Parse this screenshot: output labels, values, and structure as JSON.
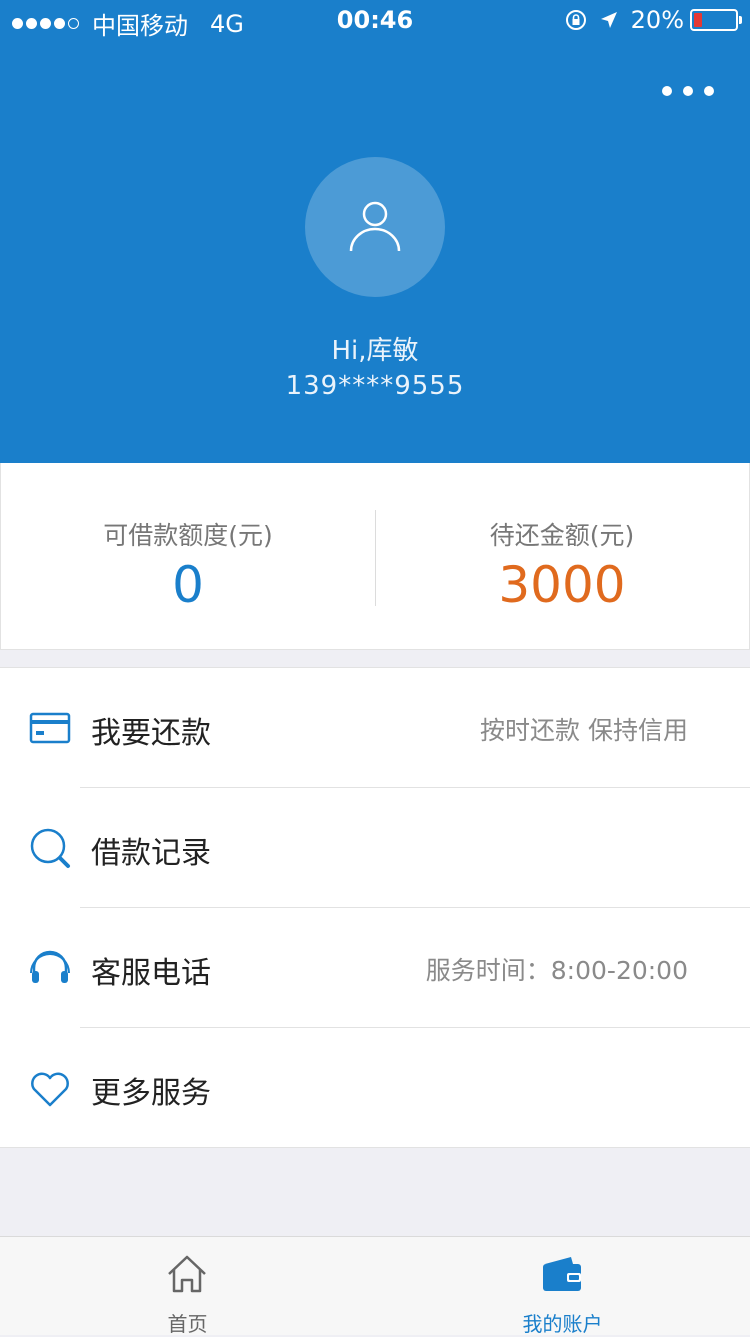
{
  "status_bar": {
    "carrier": "中国移动",
    "network": "4G",
    "time": "00:46",
    "battery_percent": "20%",
    "battery_level": 0.2
  },
  "profile": {
    "greeting": "Hi,库敏",
    "phone": "139****9555"
  },
  "stats": {
    "available_label": "可借款额度(元)",
    "available_value": "0",
    "due_label": "待还金额(元)",
    "due_value": "3000"
  },
  "menu": {
    "items": [
      {
        "label": "我要还款",
        "hint": "按时还款  保持信用",
        "icon": "card-icon"
      },
      {
        "label": "借款记录",
        "hint": "",
        "icon": "search-icon"
      },
      {
        "label": "客服电话",
        "hint": "服务时间：8:00-20:00",
        "icon": "headset-icon"
      },
      {
        "label": "更多服务",
        "hint": "",
        "icon": "heart-icon"
      }
    ]
  },
  "tabbar": {
    "home_label": "首页",
    "account_label": "我的账户"
  },
  "colors": {
    "primary": "#1a7fcb",
    "due": "#e06a1e",
    "battery_low": "#e53935"
  }
}
